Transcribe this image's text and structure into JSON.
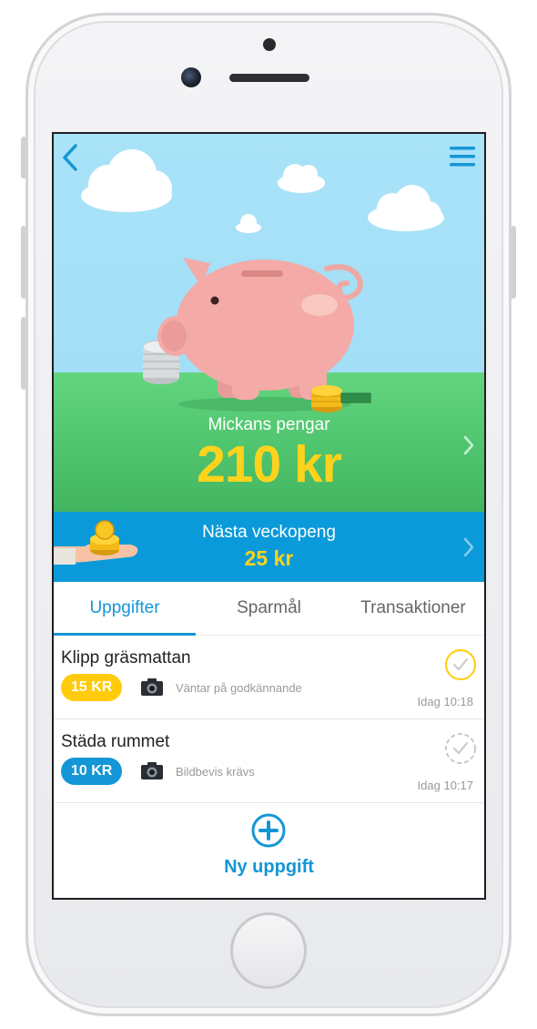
{
  "hero": {
    "owner_label": "Mickans pengar",
    "balance": "210 kr"
  },
  "allowance": {
    "title": "Nästa veckopeng",
    "amount": "25 kr"
  },
  "tabs": [
    {
      "label": "Uppgifter",
      "active": true
    },
    {
      "label": "Sparmål",
      "active": false
    },
    {
      "label": "Transaktioner",
      "active": false
    }
  ],
  "tasks": [
    {
      "name": "Klipp gräsmattan",
      "reward": "15 KR",
      "reward_color": "#ffcb0a",
      "status": "Väntar på godkännande",
      "time": "Idag 10:18",
      "check_color": "#ffcb0a"
    },
    {
      "name": "Städa rummet",
      "reward": "10 KR",
      "reward_color": "#1596d6",
      "status": "Bildbevis krävs",
      "time": "Idag 10:17",
      "check_color": "#c8c8c8"
    }
  ],
  "new_task": {
    "label": "Ny uppgift"
  },
  "colors": {
    "accent_blue": "#1596d6",
    "gold": "#ffd31c",
    "sky": "#a9e3f8",
    "grass": "#4fc46e"
  },
  "icons": [
    "back-arrow-icon",
    "hamburger-menu-icon",
    "chevron-right-icon",
    "camera-icon",
    "checkmark-circle-icon",
    "plus-circle-icon"
  ]
}
